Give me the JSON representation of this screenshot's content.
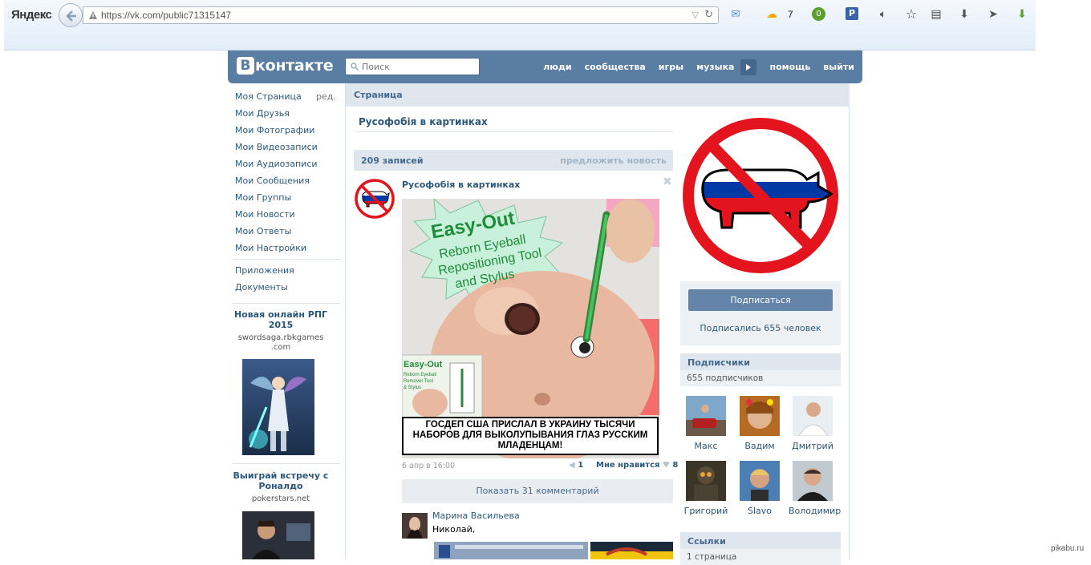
{
  "browser": {
    "brand": "Яндекс",
    "url": "https://vk.com/public71315147",
    "weather_temp": "7",
    "badge_count": "0"
  },
  "vk": {
    "logo_letter": "В",
    "logo_text": "контакте",
    "search_placeholder": "Поиск",
    "nav": [
      "люди",
      "сообщества",
      "игры",
      "музыка",
      "помощь",
      "выйти"
    ]
  },
  "left_menu": {
    "items": [
      "Моя Страница",
      "Мои Друзья",
      "Мои Фотографии",
      "Мои Видеозаписи",
      "Мои Аудиозаписи",
      "Мои Сообщения",
      "Мои Группы",
      "Мои Новости",
      "Мои Ответы",
      "Мои Настройки"
    ],
    "edit": "ред.",
    "extra": [
      "Приложения",
      "Документы"
    ],
    "ads": [
      {
        "title": "Новая онлайн РПГ 2015",
        "domain": "swordsaga.rbkgames .com"
      },
      {
        "title": "Выиграй встречу с Роналдо",
        "domain": "pokerstars.net"
      }
    ]
  },
  "main": {
    "tab": "Страница",
    "group_name": "Русофобія в картинках",
    "wall_count": "209 записей",
    "suggest": "предложить новость",
    "post": {
      "author": "Русофобія в картинках",
      "image_text": {
        "line1": "Easy-Out",
        "line2": "Reborn Eyeball",
        "line3": "Repositioning Tool",
        "line4": "and Stylus",
        "box_line1": "Easy-Out",
        "box_line2": "Reborn Eyeball",
        "box_line3": "Remover Tool",
        "box_line4": "& Stylus"
      },
      "caption": "ГОСДЕП США ПРИСЛАЛ В УКРАИНУ ТЫСЯЧИ НАБОРОВ ДЛЯ ВЫКОЛУПЫВАНИЯ ГЛАЗ РУССКИМ МЛАДЕНЦАМ!",
      "date": "6 апр в 16:00",
      "reposts": "1",
      "like_label": "Мне нравится",
      "likes": "8",
      "show_comments": "Показать 31 комментарий",
      "comment": {
        "author": "Марина Васильева",
        "text": "Николай,"
      }
    }
  },
  "right": {
    "subscribe": "Подписаться",
    "subscribed": "Подписались 655 человек",
    "subscribers_title": "Подписчики",
    "subscribers_count": "655 подписчиков",
    "members": [
      "Макс",
      "Вадим",
      "Дмитрий",
      "Григорий",
      "Slavo",
      "Володимир"
    ],
    "links_title": "Ссылки",
    "links_count": "1 страница"
  },
  "watermark": "pikabu.ru",
  "colors": {
    "vk_blue": "#597da3",
    "link": "#2b587a",
    "no_sign_red": "#e3141d",
    "flag_blue": "#0039a6"
  }
}
